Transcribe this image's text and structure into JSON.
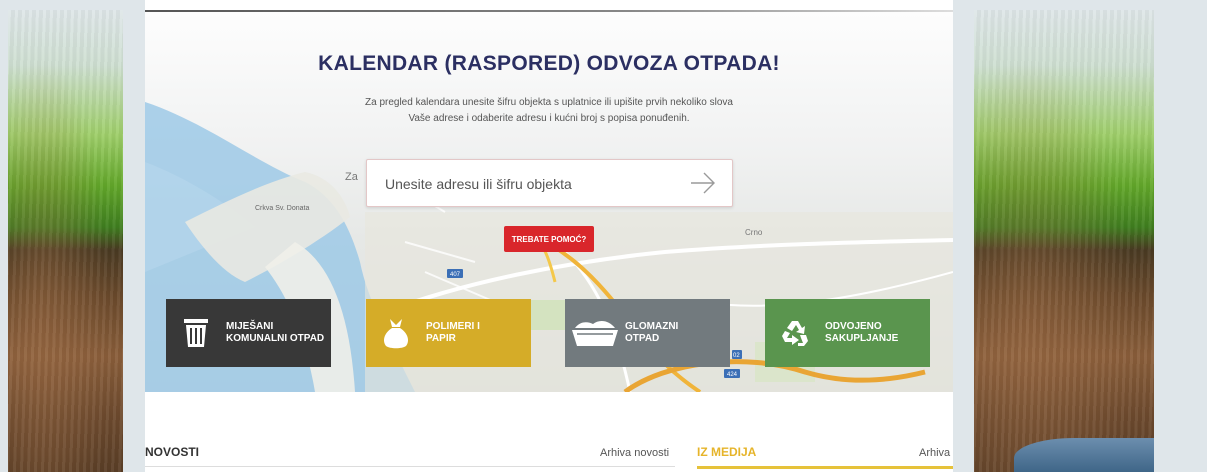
{
  "hero": {
    "title": "KALENDAR (RASPORED) ODVOZA OTPADA!",
    "description_line1": "Za pregled kalendara unesite šifru objekta s uplatnice ili upišite prvih nekoliko slova",
    "description_line2": "Vaše adrese i odaberite adresu i kućni broj s popisa ponuđenih.",
    "search_placeholder": "Unesite adresu ili šifru objekta",
    "help_button": "TREBATE POMOĆ?",
    "map_labels": {
      "church": "Crkva Sv. Donata",
      "city": "Za",
      "place": "Crno",
      "road1": "407",
      "road2": "424",
      "road3": "02"
    }
  },
  "categories": [
    {
      "line1": "MIJEŠANI",
      "line2": "KOMUNALNI OTPAD",
      "icon": "trash-bin-icon",
      "color": "#383838"
    },
    {
      "line1": "POLIMERI I",
      "line2": "PAPIR",
      "icon": "garbage-bag-icon",
      "color": "#d5ac28"
    },
    {
      "line1": "GLOMAZNI",
      "line2": "OTPAD",
      "icon": "bulky-waste-container-icon",
      "color": "#727a7e"
    },
    {
      "line1": "ODVOJENO",
      "line2": "SAKUPLJANJE",
      "icon": "recycle-icon",
      "color": "#5a954e"
    }
  ],
  "news": {
    "title": "NOVOSTI",
    "archive_link": "Arhiva novosti"
  },
  "media": {
    "title": "IZ MEDIJA",
    "archive_link": "Arhiva",
    "accent": "#e6b42a"
  }
}
